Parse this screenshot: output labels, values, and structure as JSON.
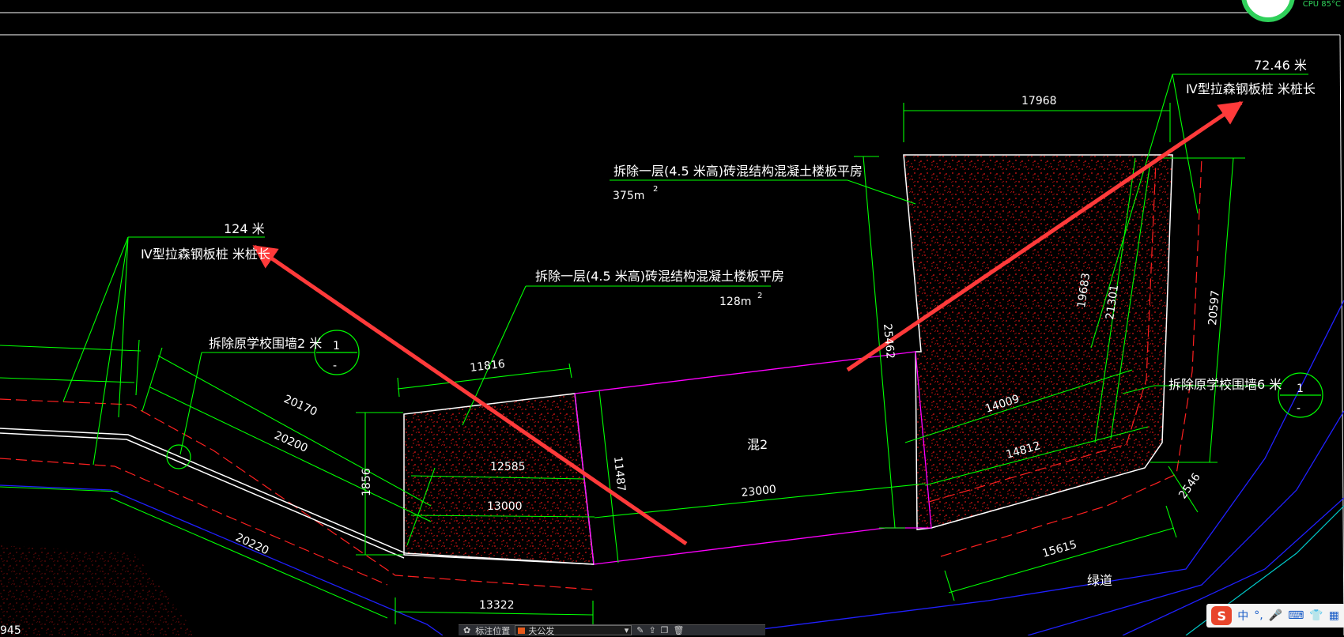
{
  "status": {
    "cpu": "CPU 85°C"
  },
  "callouts": {
    "left_pile_length": "124  米",
    "left_pile_desc": "Ⅳ型拉森钢板桩  米桩长",
    "right_pile_length": "72.46  米",
    "right_pile_desc": "Ⅳ型拉森钢板桩  米桩长",
    "demolish_top": "拆除一层(4.5  米高)砖混结构混凝土楼板平房",
    "area_top": "375m",
    "demolish_mid": "拆除一层(4.5  米高)砖混结构混凝土楼板平房",
    "area_mid": "128m",
    "superscript": "2",
    "wall_left": "拆除原学校围墙2  米",
    "wall_right": "拆除原学校围墙6  米",
    "section_num": "1",
    "section_dash": "-"
  },
  "dimensions": {
    "d17968": "17968",
    "d19683": "19683",
    "d21301": "21301",
    "d20597": "20597",
    "d25462": "25462",
    "d14009": "14009",
    "d14812": "14812",
    "d11816": "11816",
    "d12585": "12585",
    "d13000": "13000",
    "d11487": "11487",
    "d1856": "1856",
    "d23000": "23000",
    "d20170": "20170",
    "d20200": "20200",
    "d20220": "20220",
    "d13322": "13322",
    "d15615": "15615",
    "d2546": "2546",
    "d945": "945"
  },
  "labels": {
    "hun2": "混2",
    "greenway": "绿道"
  },
  "command_bar": {
    "prefix": "标注位置",
    "layer": "夫公发"
  },
  "ime": {
    "logo": "S",
    "mode": "中",
    "punct": "°,",
    "mic": "🎤",
    "keyboard": "⌨",
    "shirt": "👕",
    "grid": "▦"
  },
  "colors": {
    "green": "#00ff00",
    "white": "#ffffff",
    "red": "#ff2020",
    "magenta": "#ff00ff",
    "blue": "#0000ff",
    "cyan": "#00c8c8",
    "arrow": "#ff3a3a"
  }
}
